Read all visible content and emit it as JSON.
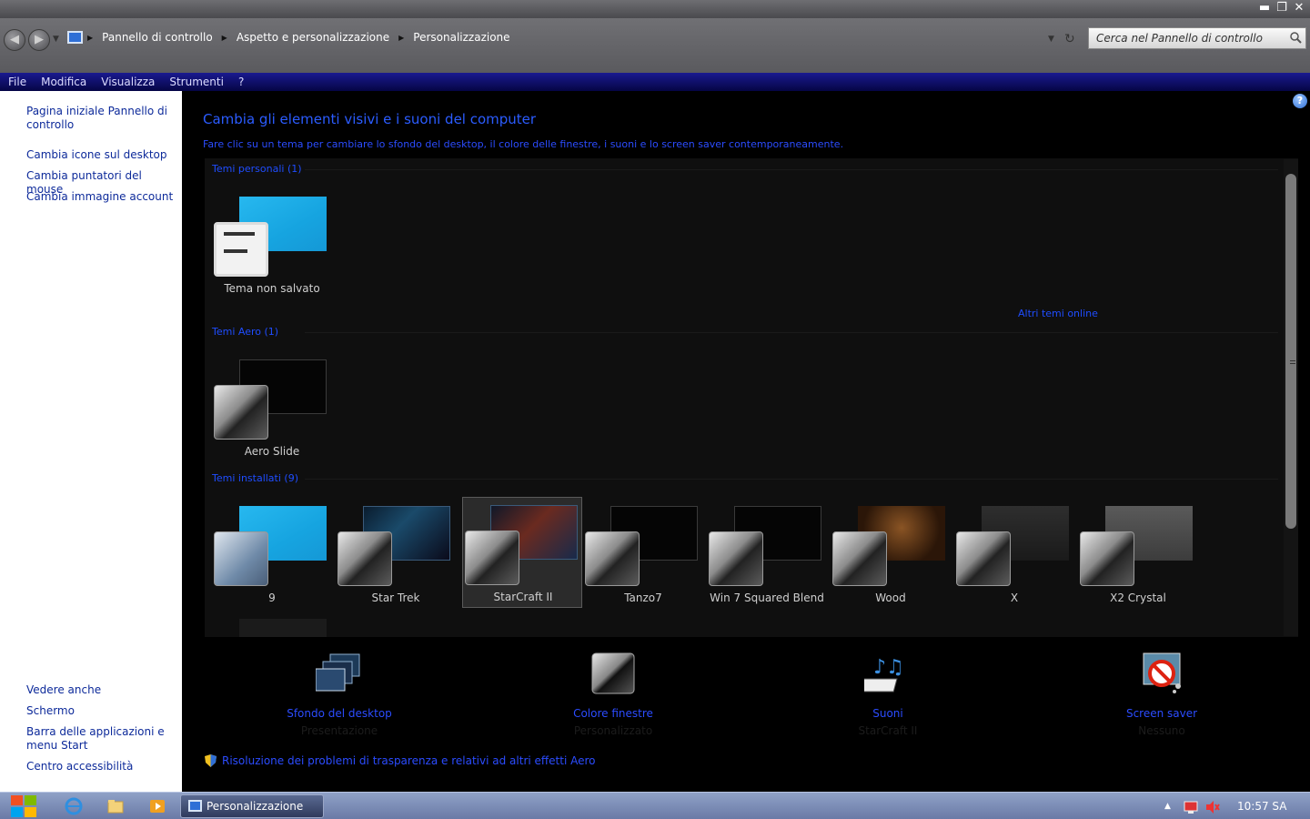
{
  "window": {
    "controls": {
      "minimize": "▬",
      "restore": "❐",
      "close": "✕"
    }
  },
  "address": {
    "crumbs": [
      "Pannello di controllo",
      "Aspetto e personalizzazione",
      "Personalizzazione"
    ],
    "search_placeholder": "Cerca nel Pannello di controllo"
  },
  "menu": [
    "File",
    "Modifica",
    "Visualizza",
    "Strumenti",
    "?"
  ],
  "sidebar": {
    "home": "Pagina iniziale Pannello di controllo",
    "links": [
      "Cambia icone sul desktop",
      "Cambia puntatori del mouse",
      "Cambia immagine account"
    ],
    "see_also_title": "Vedere anche",
    "see_also": [
      "Schermo",
      "Barra delle applicazioni e menu Start",
      "Centro accessibilità"
    ]
  },
  "main": {
    "title": "Cambia gli elementi visivi e i suoni del computer",
    "description": "Fare clic su un tema per cambiare lo sfondo del desktop, il colore delle finestre, i suoni e lo screen saver contemporaneamente.",
    "online_link": "Altri temi online",
    "groups": {
      "personal": {
        "title": "Temi personali (1)",
        "themes": [
          "Tema non salvato"
        ]
      },
      "aero": {
        "title": "Temi Aero (1)",
        "themes": [
          "Aero Slide"
        ]
      },
      "installed": {
        "title": "Temi installati (9)",
        "themes": [
          "9",
          "Star Trek",
          "StarCraft II",
          "Tanzo7",
          "Win 7 Squared Blend",
          "Wood",
          "X",
          "X2 Crystal"
        ]
      }
    },
    "settings": [
      {
        "title": "Sfondo del desktop",
        "subtitle": "Presentazione"
      },
      {
        "title": "Colore finestre",
        "subtitle": "Personalizzato"
      },
      {
        "title": "Suoni",
        "subtitle": "StarCraft II"
      },
      {
        "title": "Screen saver",
        "subtitle": "Nessuno"
      }
    ],
    "troubleshoot": "Risoluzione dei problemi di trasparenza e relativi ad altri effetti Aero"
  },
  "taskbar": {
    "task_label": "Personalizzazione",
    "clock": "10:57 SA"
  },
  "colors": {
    "link_blue": "#2b4cff",
    "menubar": "#0a0a6a",
    "sidebar_link": "#0d2a9a"
  }
}
